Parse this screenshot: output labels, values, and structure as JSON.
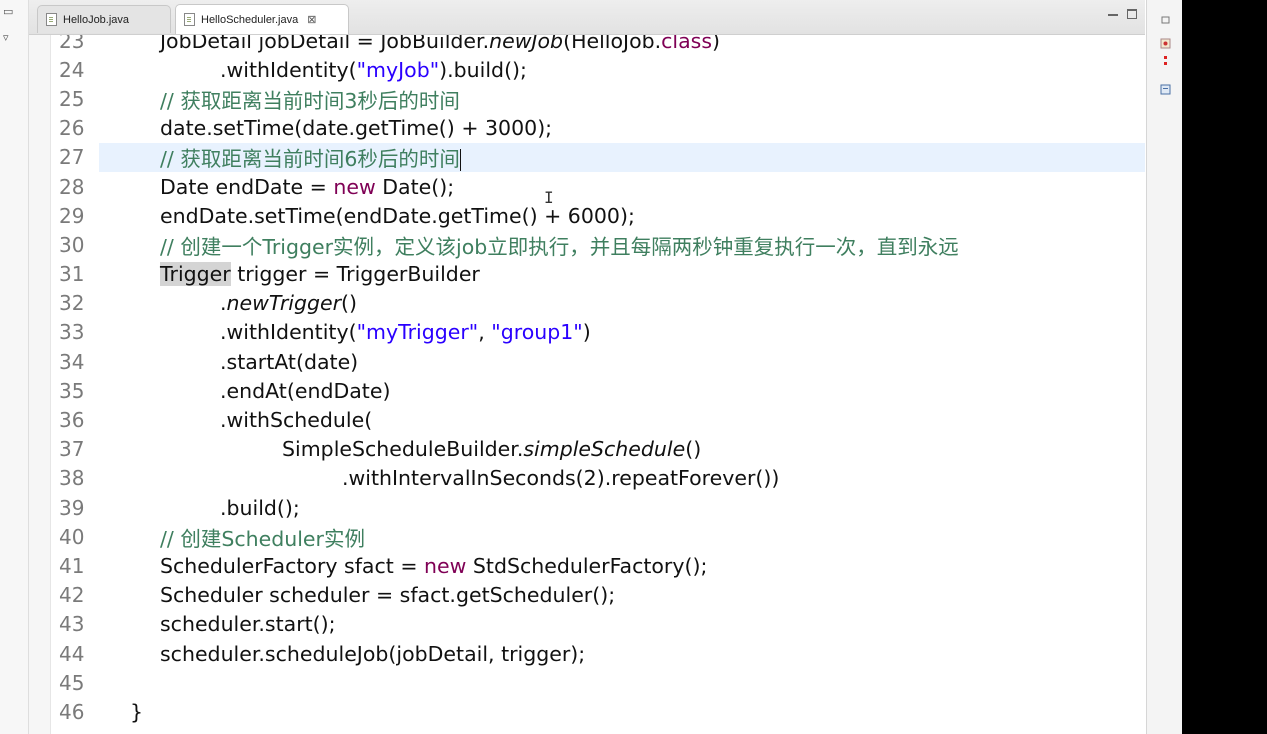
{
  "tabs": [
    {
      "label": "HelloJob.java",
      "active": false
    },
    {
      "label": "HelloScheduler.java",
      "active": true,
      "close_icon": "⊠"
    }
  ],
  "colors": {
    "keyword": "#7f0055",
    "string": "#2a00ff",
    "comment": "#3f7f5f",
    "current_line": "#e8f2fe"
  },
  "editor": {
    "lines": [
      {
        "no": "23",
        "code": [
          "JobDetail jobDetail = JobBuilder.",
          ".",
          "newJob",
          "(HelloJob.",
          "class",
          ")"
        ]
      },
      {
        "no": "24",
        "code": [
          ".withIdentity(",
          "\"myJob\"",
          ").build();"
        ]
      },
      {
        "no": "25",
        "code": [
          "// 获取距离当前时间3秒后的时间"
        ]
      },
      {
        "no": "26",
        "code": [
          "date.setTime(date.getTime() + 3000);"
        ]
      },
      {
        "no": "27",
        "code": [
          "// 获取距离当前时间6秒后的时间"
        ]
      },
      {
        "no": "28",
        "code": [
          "Date endDate = ",
          "new",
          " Date();"
        ]
      },
      {
        "no": "29",
        "code": [
          "endDate.setTime(endDate.getTime() + 6000);"
        ]
      },
      {
        "no": "30",
        "code": [
          "// 创建一个Trigger实例，定义该job立即执行，并且每隔两秒钟重复执行一次，直到永远"
        ]
      },
      {
        "no": "31",
        "code": [
          "Trigger",
          " trigger = TriggerBuilder"
        ]
      },
      {
        "no": "32",
        "code": [
          ".",
          "newTrigger",
          "()"
        ]
      },
      {
        "no": "33",
        "code": [
          ".withIdentity(",
          "\"myTrigger\"",
          ", ",
          "\"group1\"",
          ")"
        ]
      },
      {
        "no": "34",
        "code": [
          ".startAt(date)"
        ]
      },
      {
        "no": "35",
        "code": [
          ".endAt(endDate)"
        ]
      },
      {
        "no": "36",
        "code": [
          ".withSchedule("
        ]
      },
      {
        "no": "37",
        "code": [
          "SimpleScheduleBuilder.",
          "simpleSchedule",
          "()"
        ]
      },
      {
        "no": "38",
        "code": [
          ".withIntervalInSeconds(2).repeatForever())"
        ]
      },
      {
        "no": "39",
        "code": [
          ".build();"
        ]
      },
      {
        "no": "40",
        "code": [
          "// 创建Scheduler实例"
        ]
      },
      {
        "no": "41",
        "code": [
          "SchedulerFactory sfact = ",
          "new",
          " StdSchedulerFactory();"
        ]
      },
      {
        "no": "42",
        "code": [
          "Scheduler scheduler = sfact.getScheduler();"
        ]
      },
      {
        "no": "43",
        "code": [
          "scheduler.start();"
        ]
      },
      {
        "no": "44",
        "code": [
          "scheduler.scheduleJob(jobDetail, trigger);"
        ]
      },
      {
        "no": "45",
        "code": [
          ""
        ]
      },
      {
        "no": "46",
        "code": [
          "}"
        ]
      }
    ]
  }
}
